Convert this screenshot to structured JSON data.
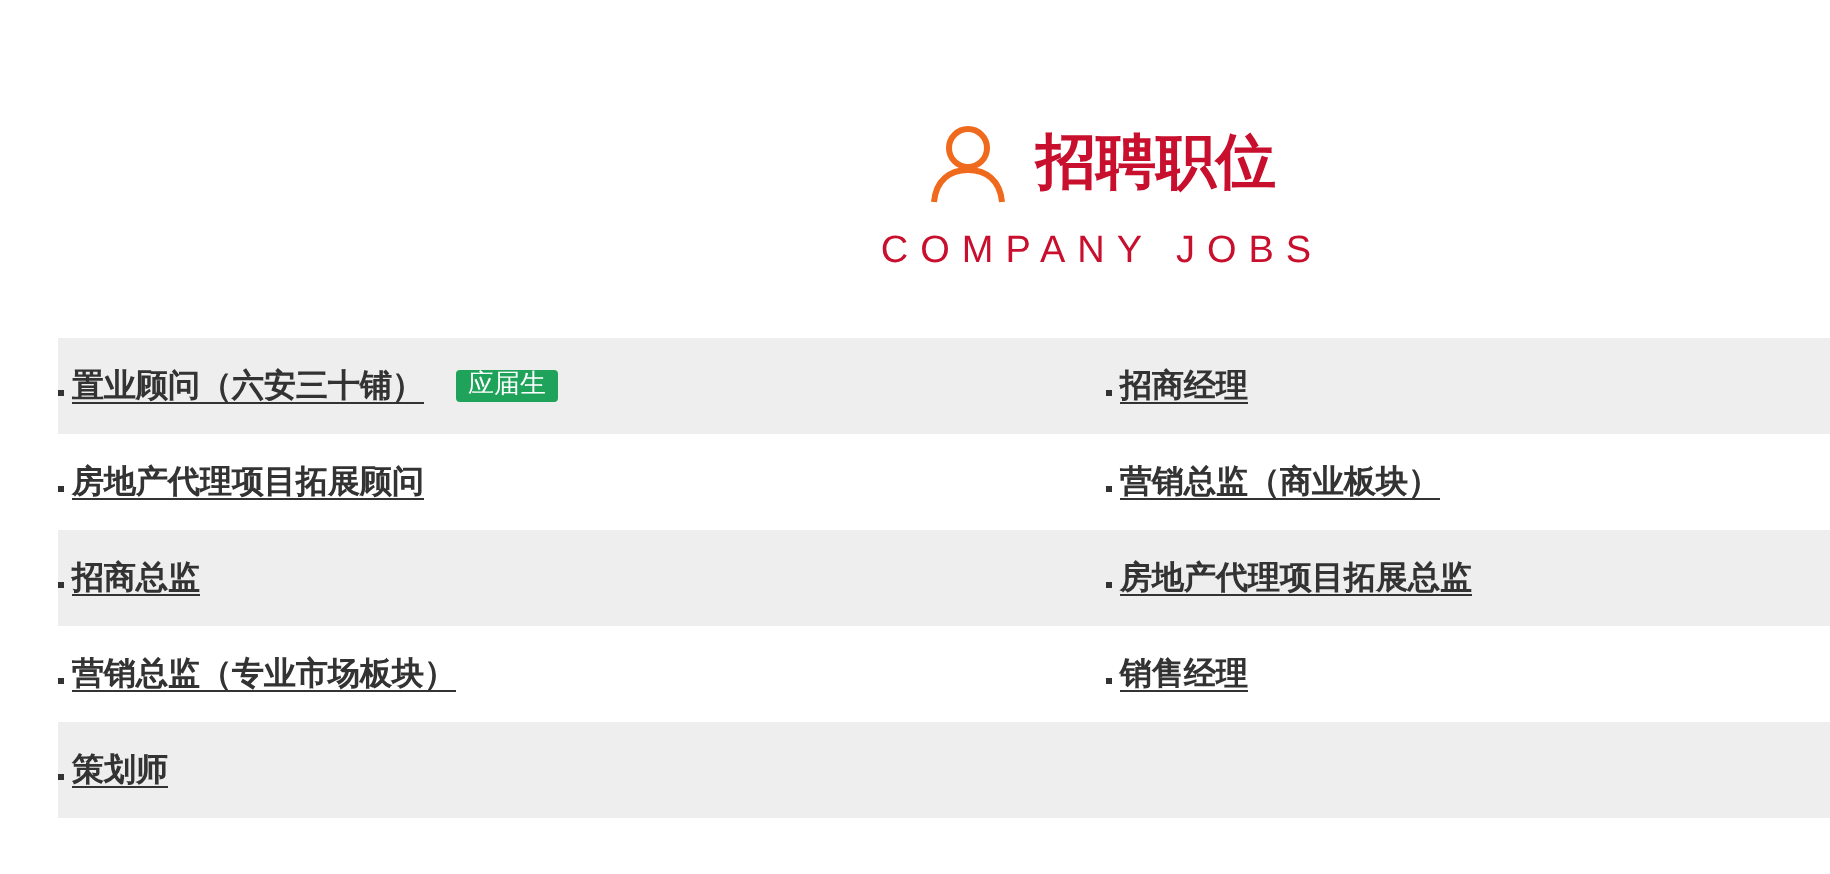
{
  "header": {
    "title": "招聘职位",
    "subtitle": "COMPANY JOBS"
  },
  "rows": [
    [
      {
        "title": "置业顾问（六安三十铺）",
        "badge": "应届生"
      },
      {
        "title": "招商经理"
      }
    ],
    [
      {
        "title": "房地产代理项目拓展顾问"
      },
      {
        "title": "营销总监（商业板块）"
      }
    ],
    [
      {
        "title": "招商总监"
      },
      {
        "title": "房地产代理项目拓展总监"
      }
    ],
    [
      {
        "title": "营销总监（专业市场板块）"
      },
      {
        "title": "销售经理"
      }
    ],
    [
      {
        "title": "策划师"
      }
    ]
  ]
}
